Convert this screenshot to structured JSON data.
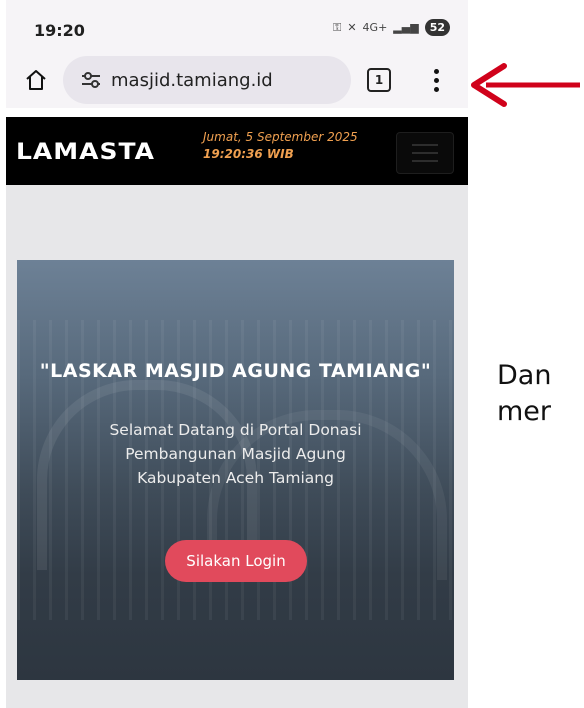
{
  "status_bar": {
    "time": "19:20",
    "signal_label": "4G+",
    "battery": "52"
  },
  "browser": {
    "url": "masjid.tamiang.id",
    "tab_count": "1"
  },
  "site_nav": {
    "logo": "LAMASTA",
    "date": "Jumat, 5 September 2025",
    "time": "19:20:36 WIB"
  },
  "hero": {
    "title": "\"LASKAR MASJID AGUNG TAMIANG\"",
    "welcome_text": "Selamat Datang di Portal Donasi Pembangunan Masjid Agung Kabupaten Aceh Tamiang",
    "login_button": "Silakan Login"
  },
  "annotation": {
    "line1": "Dan",
    "line2": "mer",
    "arrow_color": "#d0021b"
  },
  "colors": {
    "accent": "#e14a5c",
    "date_text": "#f0a050",
    "nav_bg": "#000000"
  },
  "icons": [
    "home-icon",
    "site-info-icon",
    "tabs-icon",
    "more-vert-icon",
    "menu-toggle-icon",
    "arrow-icon"
  ]
}
